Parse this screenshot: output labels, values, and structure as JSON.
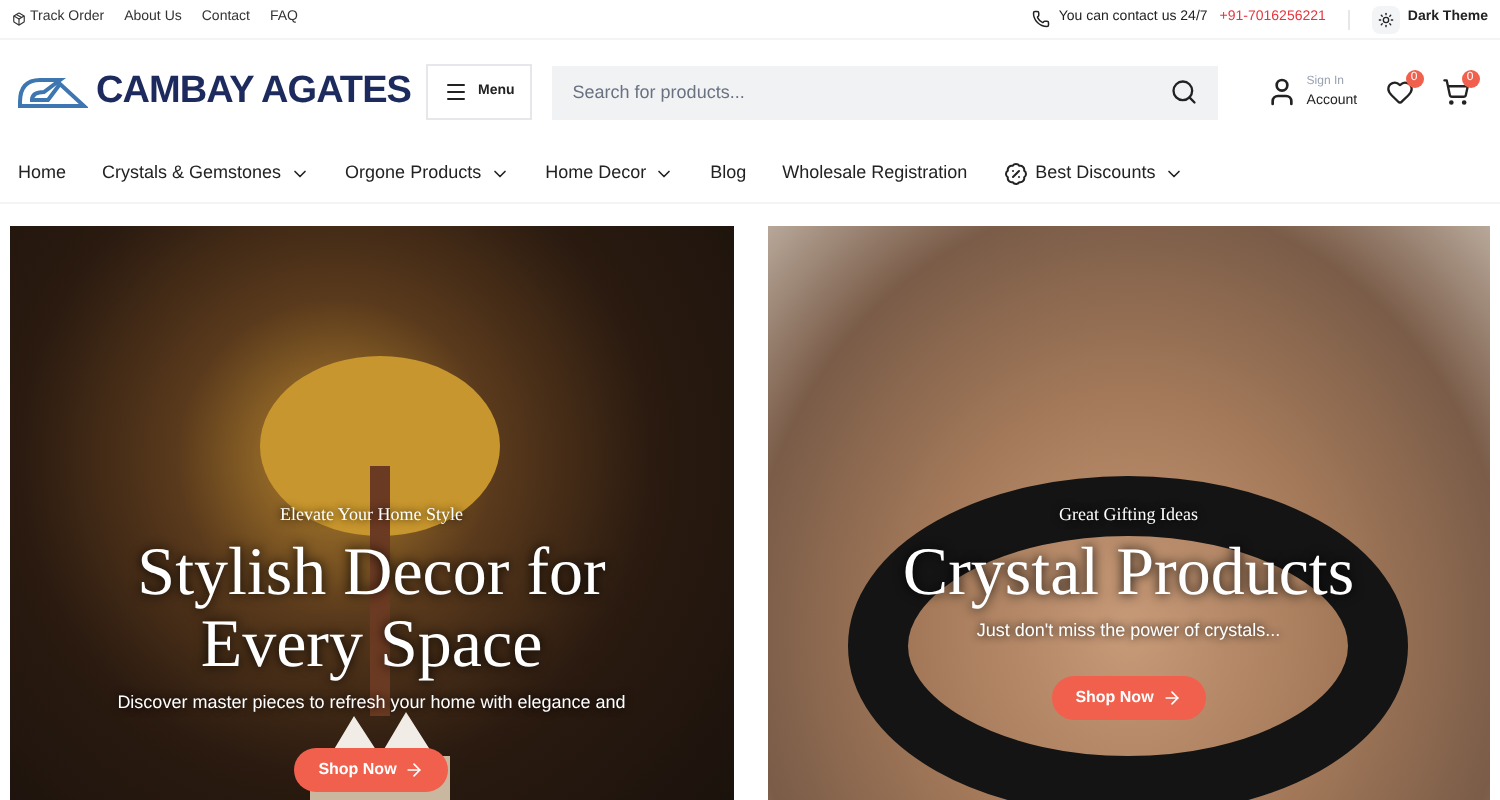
{
  "top_bar": {
    "links": [
      "Track Order",
      "About Us",
      "Contact",
      "FAQ"
    ],
    "contact_text": "You can contact us 24/7",
    "phone": "+91-7016256221",
    "theme_toggle": "Dark Theme"
  },
  "header": {
    "logo": "CAMBAY AGATES",
    "menu_button": "Menu",
    "search": {
      "placeholder": "Search for products..."
    },
    "account": {
      "caption": "Sign In",
      "label": "Account"
    },
    "wishlist_count": "0",
    "cart_count": "0"
  },
  "nav": [
    {
      "label": "Home",
      "dropdown": false,
      "kind": "plain"
    },
    {
      "label": "Crystals & Gemstones",
      "dropdown": true,
      "kind": "plain"
    },
    {
      "label": "Orgone Products",
      "dropdown": true,
      "kind": "plain"
    },
    {
      "label": "Home Decor",
      "dropdown": true,
      "kind": "plain"
    },
    {
      "label": "Blog",
      "dropdown": false,
      "kind": "plain"
    },
    {
      "label": "Wholesale Registration",
      "dropdown": false,
      "kind": "plain"
    },
    {
      "label": "Best Discounts",
      "dropdown": true,
      "kind": "discount"
    }
  ],
  "banners": [
    {
      "kicker": "Elevate Your Home Style",
      "title": "Stylish Decor for Every Space",
      "subtitle": "Discover master pieces to refresh your home with elegance and",
      "button": "Shop Now",
      "kind": "decor"
    },
    {
      "kicker": "Great Gifting Ideas",
      "title": "Crystal Products",
      "subtitle": "Just don't miss the power of crystals...",
      "button": "Shop Now",
      "kind": "bracelet"
    }
  ]
}
